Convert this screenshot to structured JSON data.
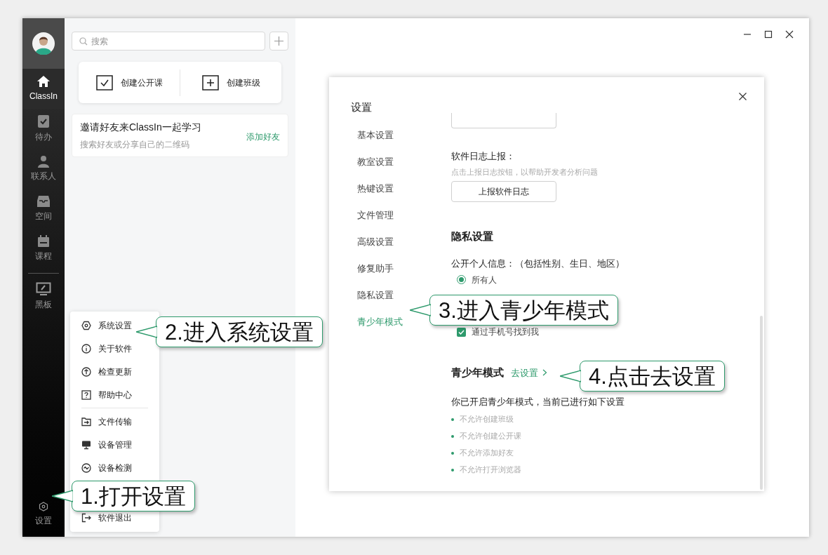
{
  "sidebar": {
    "items": [
      {
        "label": "ClassIn",
        "selected": true
      },
      {
        "label": "待办",
        "selected": false
      },
      {
        "label": "联系人",
        "selected": false
      },
      {
        "label": "空间",
        "selected": false
      },
      {
        "label": "课程",
        "selected": false
      },
      {
        "label": "黑板",
        "selected": false
      }
    ],
    "settings_label": "设置"
  },
  "search": {
    "placeholder": "搜索"
  },
  "quick_actions": [
    "创建公开课",
    "创建班级"
  ],
  "invite_card": {
    "title": "邀请好友来ClassIn一起学习",
    "subtitle": "搜索好友或分享自己的二维码",
    "action": "添加好友"
  },
  "settings_menu": [
    "系统设置",
    "关于软件",
    "检查更新",
    "帮助中心",
    "文件传输",
    "设备管理",
    "设备检测",
    "软件退出"
  ],
  "dialog": {
    "title": "设置",
    "nav": [
      {
        "label": "基本设置",
        "selected": false
      },
      {
        "label": "教室设置",
        "selected": false
      },
      {
        "label": "热键设置",
        "selected": false
      },
      {
        "label": "文件管理",
        "selected": false
      },
      {
        "label": "高级设置",
        "selected": false
      },
      {
        "label": "修复助手",
        "selected": false
      },
      {
        "label": "隐私设置",
        "selected": false
      },
      {
        "label": "青少年模式",
        "selected": true
      }
    ],
    "log": {
      "label": "软件日志上报：",
      "hint": "点击上报日志按钮，以帮助开发者分析问题",
      "button": "上报软件日志"
    },
    "privacy": {
      "heading": "隐私设置",
      "label": "公开个人信息：（包括性别、生日、地区）",
      "options": [
        {
          "label": "所有人",
          "selected": true
        }
      ],
      "phone_search": {
        "label": "通过手机号找到我",
        "checked": true
      }
    },
    "youth": {
      "heading": "青少年模式",
      "link": "去设置",
      "description": "你已开启青少年模式，当前已进行如下设置",
      "rules": [
        "不允许创建班级",
        "不允许创建公开课",
        "不允许添加好友",
        "不允许打开浏览器"
      ]
    }
  },
  "callouts": [
    "1.打开设置",
    "2.进入系统设置",
    "3.进入青少年模式",
    "4.点击去设置"
  ]
}
